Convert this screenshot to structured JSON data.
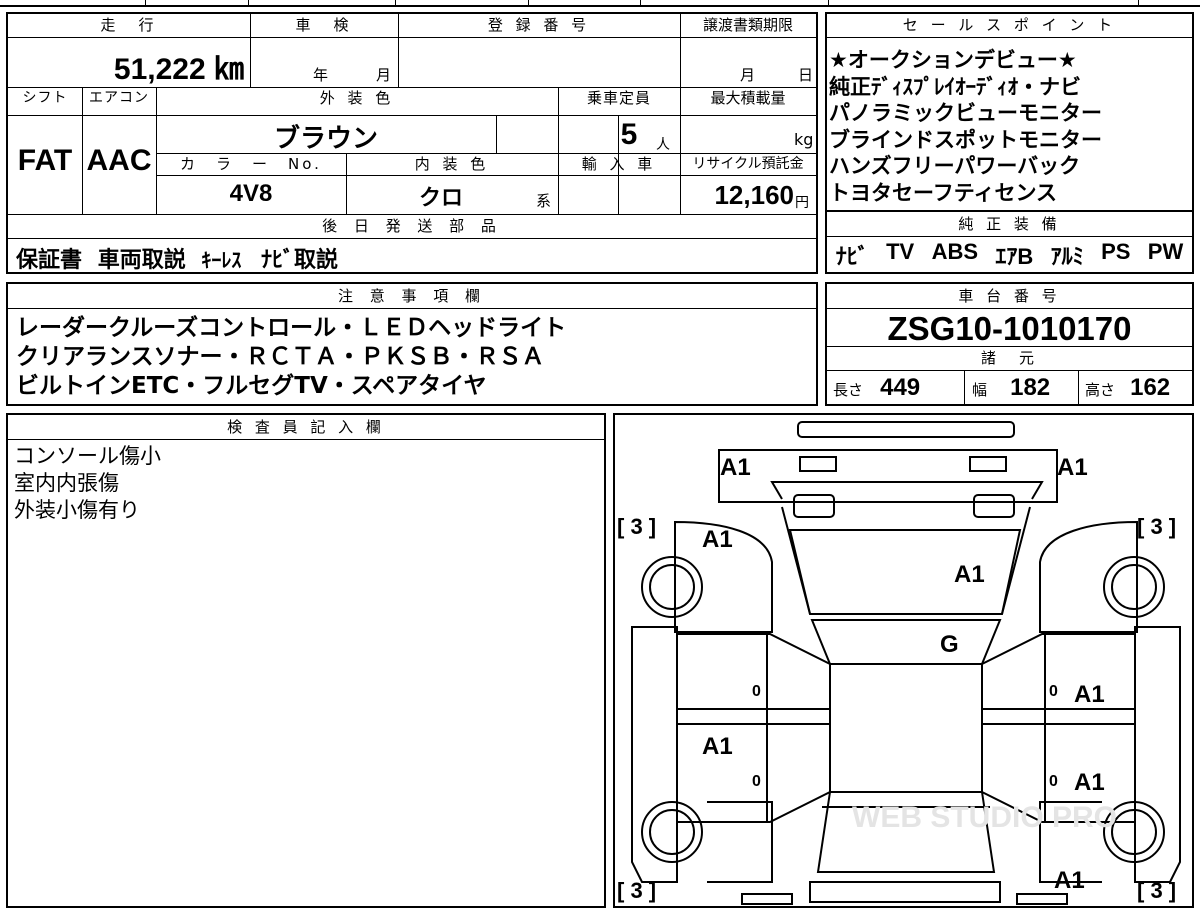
{
  "top_table": {
    "headers": {
      "mileage": "走　行",
      "inspection": "車　検",
      "registration": "登 録 番 号",
      "transfer_deadline": "譲渡書類期限",
      "shift": "シフト",
      "aircon": "エアコン",
      "exterior_color": "外 装 色",
      "capacity": "乗車定員",
      "max_load": "最大積載量",
      "color_no": "カ　ラ　ー　No.",
      "interior_color": "内 装 色",
      "import": "輸 入 車",
      "recycle_fee": "リサイクル預託金",
      "later_parts": "後 日 発 送 部 品"
    },
    "mileage_value": "51,222 ㎞",
    "inspection_year": "年",
    "inspection_month": "月",
    "transfer_month": "月",
    "transfer_day": "日",
    "shift_value": "FAT",
    "aircon_value": "AAC",
    "exterior_color_value": "ブラウン",
    "capacity_value": "5",
    "capacity_unit": "人",
    "max_load_unit": "kg",
    "color_no_value": "4V8",
    "interior_color_value": "クロ",
    "interior_suffix": "系",
    "recycle_fee_value": "12,160",
    "recycle_fee_unit": "円",
    "later_parts_items": [
      "保証書",
      "車両取説",
      "ｷｰﾚｽ",
      "ﾅﾋﾞ取説"
    ]
  },
  "sales_points": {
    "header": "セ ー ル ス ポ イ ン ト",
    "lines": [
      "★オークションデビュー★",
      "純正ﾃﾞｨｽﾌﾟﾚｲｵｰﾃﾞｨｵ・ナビ",
      "パノラミックビューモニター",
      "ブラインドスポットモニター",
      "ハンズフリーパワーバック",
      "トヨタセーフティセンス"
    ]
  },
  "factory_equipment": {
    "header": "純 正 装 備",
    "items": [
      "ﾅﾋﾞ",
      "TV",
      "ABS",
      "ｴｱB",
      "ｱﾙﾐ",
      "PS",
      "PW"
    ]
  },
  "notes": {
    "header": "注 意 事 項 欄",
    "lines": [
      "レーダークルーズコントロール・ＬＥＤヘッドライト",
      "クリアランスソナー・ＲＣＴＡ・ＰＫＳＢ・ＲＳＡ",
      "ビルトインETC・フルセグTV・スペアタイヤ"
    ]
  },
  "chassis": {
    "header": "車 台 番 号",
    "number": "ZSG10-1010170"
  },
  "specs": {
    "header": "諸　元",
    "length_label": "長さ",
    "length_value": "449",
    "width_label": "幅",
    "width_value": "182",
    "height_label": "高さ",
    "height_value": "162"
  },
  "inspector": {
    "header": "検 査 員 記 入 欄",
    "lines": [
      "コンソール傷小",
      "室内内張傷",
      "外装小傷有り"
    ]
  },
  "diagram": {
    "tire_marks": [
      "[ 3 ]",
      "[ 3 ]",
      "[ 3 ]",
      "[ 3 ]"
    ],
    "damage_codes": {
      "front_left": "A1",
      "front_right": "A1",
      "left_front_fender": "A1",
      "hood": "A1",
      "windshield": "G",
      "right_front_door": "A1",
      "left_rear_door": "A1",
      "right_rear_door": "A1",
      "rear_right": "A1"
    },
    "door_marks": [
      "0",
      "0",
      "0",
      "0"
    ],
    "watermark": "WEB STUDIO PRO"
  }
}
